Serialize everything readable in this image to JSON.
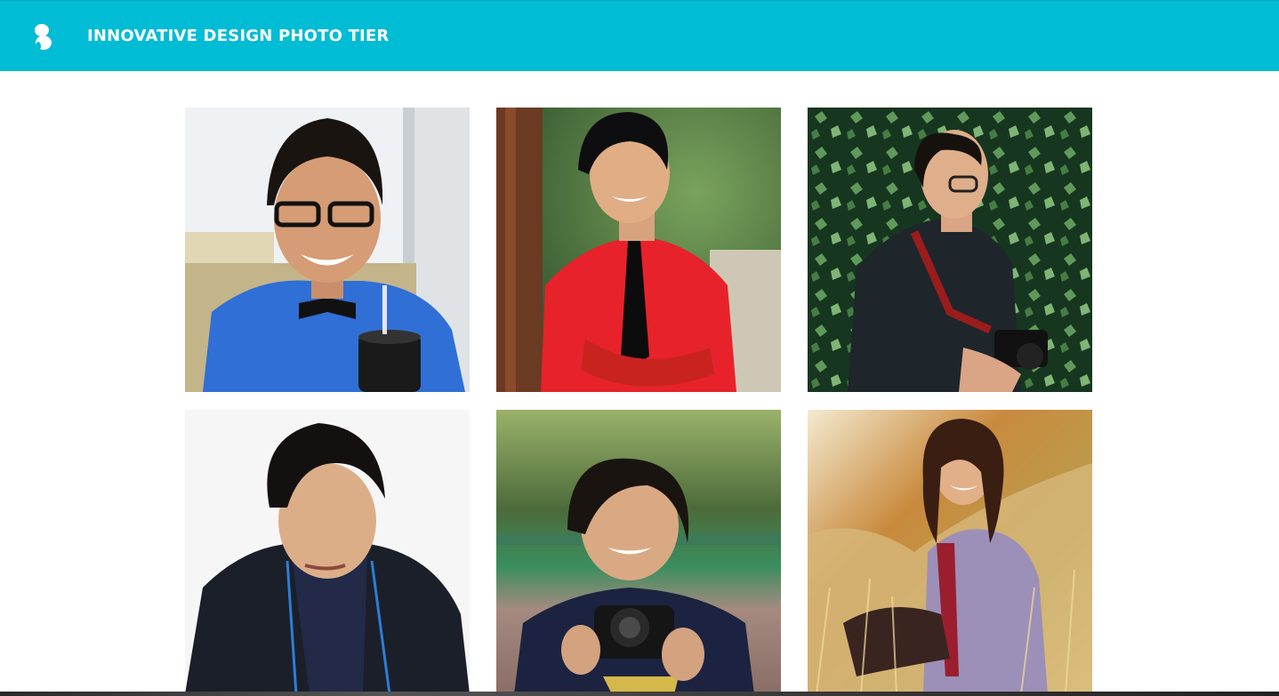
{
  "header": {
    "title": "INNOVATIVE DESIGN PHOTO TIER",
    "logo_icon": "innovative-design-logo-icon",
    "background_color": "#00bcd4"
  },
  "gallery": {
    "photos": [
      {
        "subject": "man-blue-shirt-bowtie",
        "shirt_color": "#2f6fd6",
        "background_color": "#e9eef2"
      },
      {
        "subject": "man-red-shirt-black-tie",
        "shirt_color": "#e8222a",
        "background_color": "#3f6b3a"
      },
      {
        "subject": "man-jacket-camera-ivy",
        "shirt_color": "#1e252b",
        "background_color": "#234a2a"
      },
      {
        "subject": "man-dark-hoodie",
        "shirt_color": "#1b1f2a",
        "background_color": "#f6f6f6"
      },
      {
        "subject": "man-holding-camera",
        "shirt_color": "#1c2340",
        "background_color": "#6d8a4a"
      },
      {
        "subject": "woman-sitting-in-grass",
        "shirt_color": "#9c8fb8",
        "background_color": "#d7b87a"
      }
    ]
  }
}
